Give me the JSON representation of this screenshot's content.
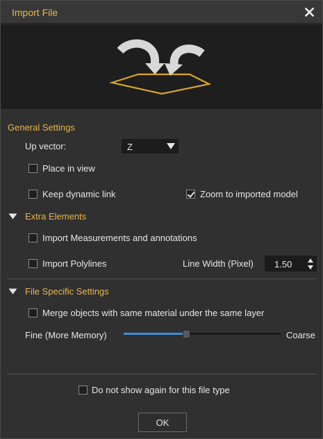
{
  "window": {
    "title": "Import File"
  },
  "icons": {
    "close": "close-icon",
    "banner": "import-arrows-plane-icon"
  },
  "colors": {
    "accent": "#e8b64a",
    "slider": "#3d8fd8",
    "background": "#303030"
  },
  "general": {
    "title": "General Settings",
    "up_vector_label": "Up vector:",
    "up_vector_value": "Z",
    "place_in_view_label": "Place in view",
    "place_in_view_checked": false,
    "keep_dynamic_link_label": "Keep dynamic link",
    "keep_dynamic_link_checked": false,
    "zoom_label": "Zoom to imported model",
    "zoom_checked": true
  },
  "extra": {
    "title": "Extra Elements",
    "measurements_label": "Import Measurements and annotations",
    "measurements_checked": false,
    "polylines_label": "Import Polylines",
    "polylines_checked": false,
    "line_width_label": "Line Width (Pixel)",
    "line_width_value": "1.50"
  },
  "file_specific": {
    "title": "File Specific Settings",
    "merge_label": "Merge objects with same material under the same layer",
    "merge_checked": false,
    "fine_label": "Fine (More Memory)",
    "coarse_label": "Coarse",
    "slider_value_fraction": 0.4
  },
  "footer": {
    "do_not_show_label": "Do not show again for this file type",
    "do_not_show_checked": false,
    "ok_label": "OK"
  }
}
